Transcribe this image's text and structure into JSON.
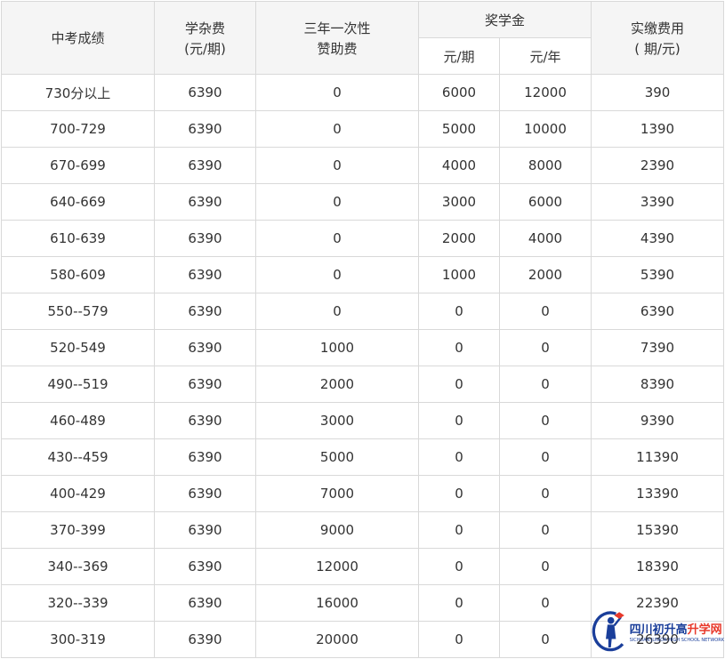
{
  "header": {
    "score": "中考成绩",
    "tuition_line1": "学杂费",
    "tuition_line2": "(元/期)",
    "sponsor_line1": "三年一次性",
    "sponsor_line2": "赞助费",
    "scholarship": "奖学金",
    "scholarship_per_term": "元/期",
    "scholarship_per_year": "元/年",
    "actual_line1": "实缴费用",
    "actual_line2": "( 期/元)"
  },
  "rows": [
    {
      "score": "730分以上",
      "tuition": "6390",
      "sponsor": "0",
      "sch_term": "6000",
      "sch_year": "12000",
      "actual": "390"
    },
    {
      "score": "700-729",
      "tuition": "6390",
      "sponsor": "0",
      "sch_term": "5000",
      "sch_year": "10000",
      "actual": "1390"
    },
    {
      "score": "670-699",
      "tuition": "6390",
      "sponsor": "0",
      "sch_term": "4000",
      "sch_year": "8000",
      "actual": "2390"
    },
    {
      "score": "640-669",
      "tuition": "6390",
      "sponsor": "0",
      "sch_term": "3000",
      "sch_year": "6000",
      "actual": "3390"
    },
    {
      "score": "610-639",
      "tuition": "6390",
      "sponsor": "0",
      "sch_term": "2000",
      "sch_year": "4000",
      "actual": "4390"
    },
    {
      "score": "580-609",
      "tuition": "6390",
      "sponsor": "0",
      "sch_term": "1000",
      "sch_year": "2000",
      "actual": "5390"
    },
    {
      "score": "550--579",
      "tuition": "6390",
      "sponsor": "0",
      "sch_term": "0",
      "sch_year": "0",
      "actual": "6390"
    },
    {
      "score": "520-549",
      "tuition": "6390",
      "sponsor": "1000",
      "sch_term": "0",
      "sch_year": "0",
      "actual": "7390"
    },
    {
      "score": "490--519",
      "tuition": "6390",
      "sponsor": "2000",
      "sch_term": "0",
      "sch_year": "0",
      "actual": "8390"
    },
    {
      "score": "460-489",
      "tuition": "6390",
      "sponsor": "3000",
      "sch_term": "0",
      "sch_year": "0",
      "actual": "9390"
    },
    {
      "score": "430--459",
      "tuition": "6390",
      "sponsor": "5000",
      "sch_term": "0",
      "sch_year": "0",
      "actual": "11390"
    },
    {
      "score": "400-429",
      "tuition": "6390",
      "sponsor": "7000",
      "sch_term": "0",
      "sch_year": "0",
      "actual": "13390"
    },
    {
      "score": "370-399",
      "tuition": "6390",
      "sponsor": "9000",
      "sch_term": "0",
      "sch_year": "0",
      "actual": "15390"
    },
    {
      "score": "340--369",
      "tuition": "6390",
      "sponsor": "12000",
      "sch_term": "0",
      "sch_year": "0",
      "actual": "18390"
    },
    {
      "score": "320--339",
      "tuition": "6390",
      "sponsor": "16000",
      "sch_term": "0",
      "sch_year": "0",
      "actual": "22390"
    },
    {
      "score": "300-319",
      "tuition": "6390",
      "sponsor": "20000",
      "sch_term": "0",
      "sch_year": "0",
      "actual": "26390"
    }
  ],
  "watermark": {
    "title_part1": "四川初升高",
    "title_part2": "升学网",
    "subtitle": "SICHUAN JUNIOR HIGH SCHOOL NETWORK"
  },
  "colors": {
    "border": "#d9d9d9",
    "header_bg": "#f5f5f5",
    "text": "#333333",
    "watermark_blue": "#1a3e9a",
    "watermark_red": "#e8392b"
  }
}
